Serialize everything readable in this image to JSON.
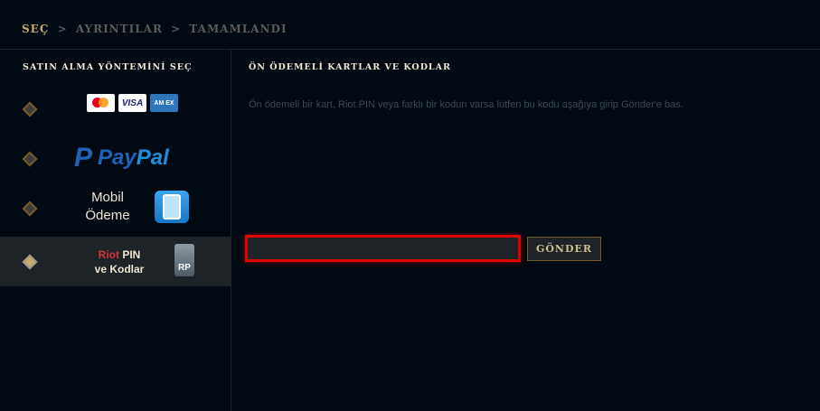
{
  "breadcrumb": {
    "step1": "SEÇ",
    "step2": "AYRINTILAR",
    "step3": "TAMAMLANDI",
    "separator": ">"
  },
  "sidebar": {
    "title": "SATIN ALMA YÖNTEMİNİ SEÇ",
    "cards": {
      "visa": "VISA",
      "amex": "AM EX"
    },
    "paypal": {
      "logo": "P",
      "pay": "Pay",
      "pal": "Pal"
    },
    "mobile": {
      "line1": "Mobil",
      "line2": "Ödeme"
    },
    "riot": {
      "riot": "Riot",
      "pin": " PIN",
      "line2": "ve Kodlar",
      "rp": "RP"
    }
  },
  "main": {
    "title": "ÖN ÖDEMELİ KARTLAR VE KODLAR",
    "description": "Ön ödemeli bir kart, Riot PIN veya farklı bir kodun varsa lütfen bu kodu aşağıya girip Gönder'e bas.",
    "code_value": "",
    "send_label": "GÖNDER"
  },
  "colors": {
    "background": "#010a13",
    "gold": "#c8aa6e",
    "highlight_border": "#e00000"
  }
}
